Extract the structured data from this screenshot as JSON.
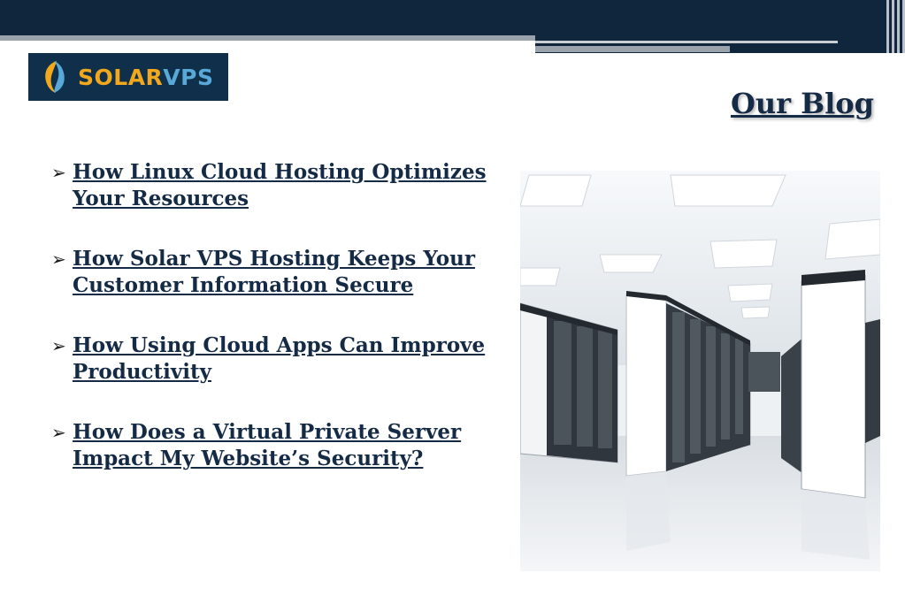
{
  "header": {
    "logo": {
      "word_solar": "SOLAR",
      "word_vps": "VPS",
      "icon": "solarvps-logo-icon"
    }
  },
  "main": {
    "title": "Our Blog",
    "posts": [
      {
        "line1": "How Linux Cloud Hosting Optimizes",
        "line2": "Your Resources"
      },
      {
        "line1": "How Solar VPS Hosting Keeps Your",
        "line2": "Customer Information Secure"
      },
      {
        "line1": "How Using Cloud Apps Can Improve",
        "line2": "Productivity"
      },
      {
        "line1": "How Does a Virtual Private Server",
        "line2": "Impact My Website’s Security?"
      }
    ],
    "bullet_icon": "arrowhead-bullet-icon",
    "image": "data-center-server-room-photo"
  },
  "colors": {
    "header_navy": "#10263d",
    "header_grey": "#9aa3ab",
    "link_navy": "#142a45",
    "logo_orange": "#f2a81d",
    "logo_blue": "#58a9d8"
  }
}
